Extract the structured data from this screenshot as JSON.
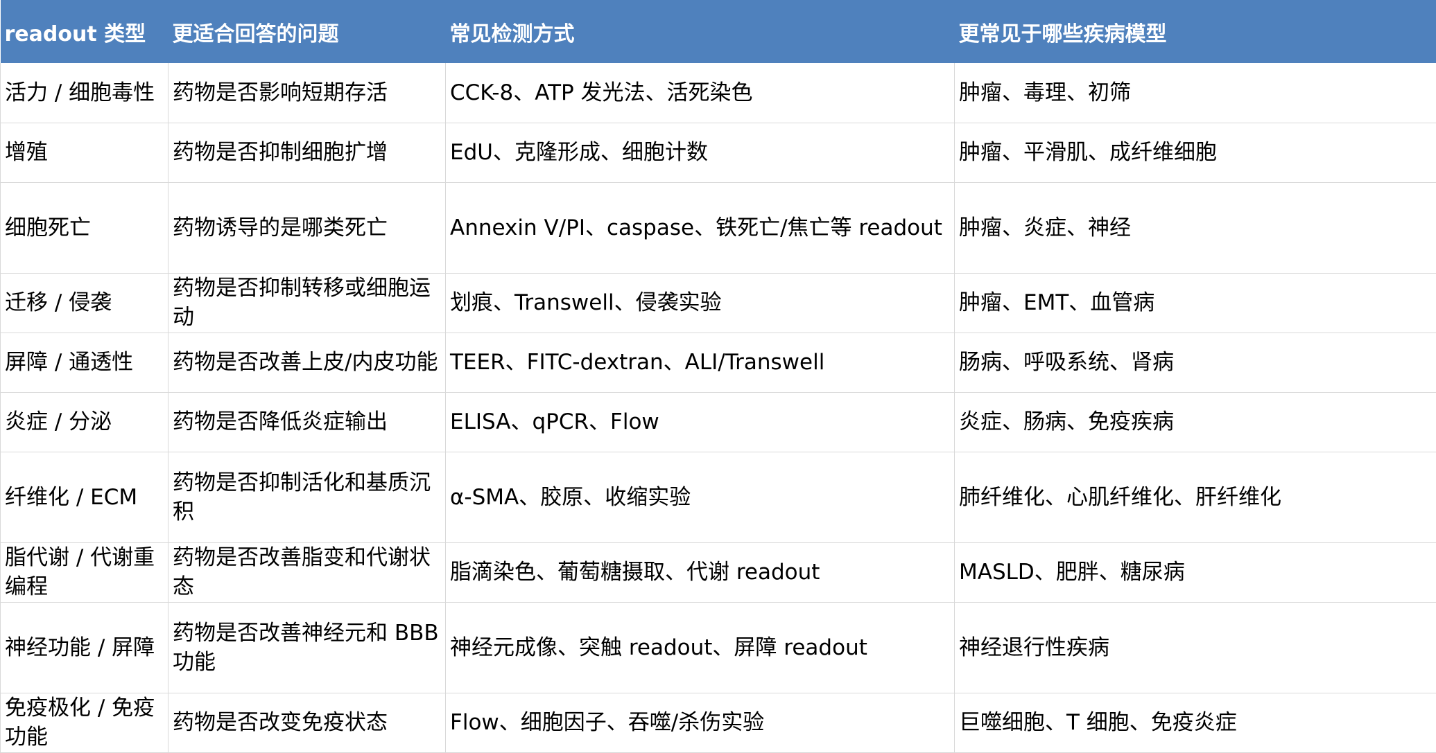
{
  "table": {
    "headers": [
      "readout 类型",
      "更适合回答的问题",
      "常见检测方式",
      "更常见于哪些疾病模型"
    ],
    "rows": [
      [
        "活力 / 细胞毒性",
        "药物是否影响短期存活",
        "CCK-8、ATP 发光法、活死染色",
        "肿瘤、毒理、初筛"
      ],
      [
        "增殖",
        "药物是否抑制细胞扩增",
        "EdU、克隆形成、细胞计数",
        "肿瘤、平滑肌、成纤维细胞"
      ],
      [
        "细胞死亡",
        "药物诱导的是哪类死亡",
        "Annexin V/PI、caspase、铁死亡/焦亡等 readout",
        "肿瘤、炎症、神经"
      ],
      [
        "迁移 / 侵袭",
        "药物是否抑制转移或细胞运动",
        "划痕、Transwell、侵袭实验",
        "肿瘤、EMT、血管病"
      ],
      [
        "屏障 / 通透性",
        "药物是否改善上皮/内皮功能",
        "TEER、FITC-dextran、ALI/Transwell",
        "肠病、呼吸系统、肾病"
      ],
      [
        "炎症 / 分泌",
        "药物是否降低炎症输出",
        "ELISA、qPCR、Flow",
        "炎症、肠病、免疫疾病"
      ],
      [
        "纤维化 / ECM",
        "药物是否抑制活化和基质沉积",
        "α-SMA、胶原、收缩实验",
        "肺纤维化、心肌纤维化、肝纤维化"
      ],
      [
        "脂代谢 / 代谢重编程",
        "药物是否改善脂变和代谢状态",
        "脂滴染色、葡萄糖摄取、代谢 readout",
        "MASLD、肥胖、糖尿病"
      ],
      [
        "神经功能 / 屏障",
        "药物是否改善神经元和 BBB 功能",
        "神经元成像、突触 readout、屏障 readout",
        "神经退行性疾病"
      ],
      [
        "免疫极化 / 免疫功能",
        "药物是否改变免疫状态",
        "Flow、细胞因子、吞噬/杀伤实验",
        "巨噬细胞、T 细胞、免疫炎症"
      ]
    ]
  },
  "colors": {
    "header_bg": "#4f81bd",
    "header_text": "#ffffff",
    "grid_line": "#d9d9d9"
  }
}
